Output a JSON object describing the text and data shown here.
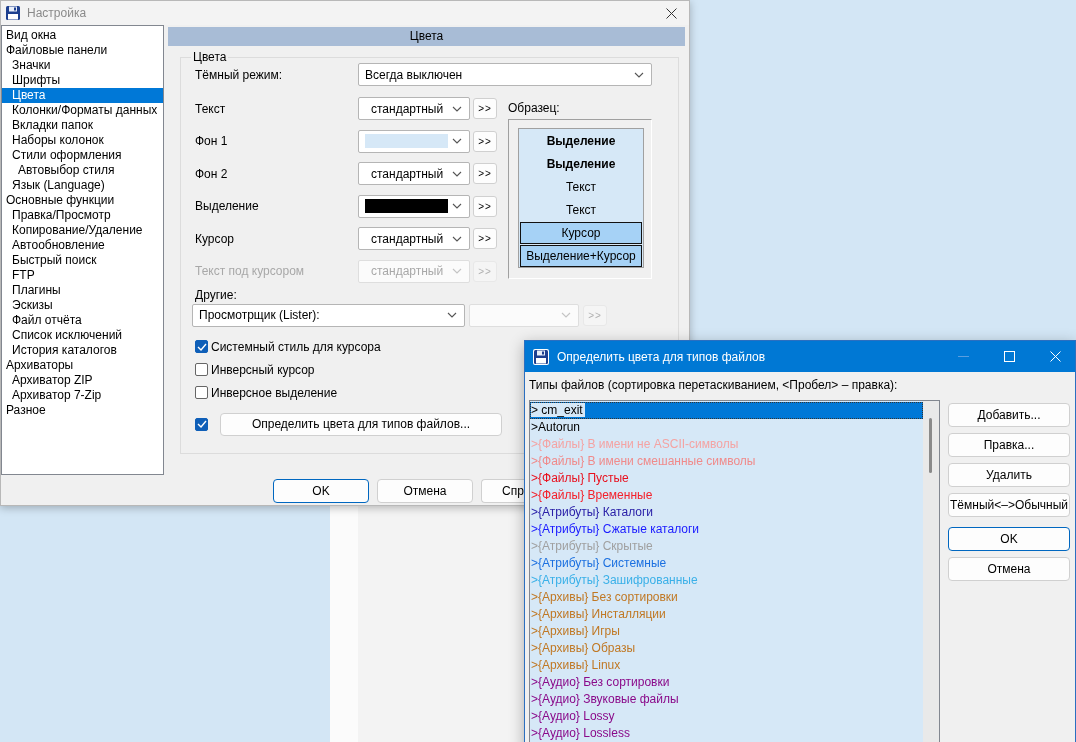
{
  "main_window": {
    "title": "Настройка",
    "tree": [
      {
        "label": "Вид окна",
        "selected": false
      },
      {
        "label": "Файловые панели",
        "selected": false,
        "children": [
          {
            "label": "Значки",
            "selected": false
          },
          {
            "label": "Шрифты",
            "selected": false
          },
          {
            "label": "Цвета",
            "selected": true
          },
          {
            "label": "Колонки/Форматы данных",
            "selected": false
          },
          {
            "label": "Вкладки папок",
            "selected": false
          },
          {
            "label": "Наборы колонок",
            "selected": false
          },
          {
            "label": "Стили оформления",
            "selected": false,
            "children": [
              {
                "label": "Автовыбор стиля",
                "selected": false
              }
            ]
          },
          {
            "label": "Язык (Language)",
            "selected": false
          }
        ]
      },
      {
        "label": "Основные функции",
        "selected": false,
        "children": [
          {
            "label": "Правка/Просмотр",
            "selected": false
          },
          {
            "label": "Копирование/Удаление",
            "selected": false
          },
          {
            "label": "Автообновление",
            "selected": false
          },
          {
            "label": "Быстрый поиск",
            "selected": false
          },
          {
            "label": "FTP",
            "selected": false
          },
          {
            "label": "Плагины",
            "selected": false
          },
          {
            "label": "Эскизы",
            "selected": false
          },
          {
            "label": "Файл отчёта",
            "selected": false
          },
          {
            "label": "Список исключений",
            "selected": false
          },
          {
            "label": "История каталогов",
            "selected": false
          }
        ]
      },
      {
        "label": "Архиваторы",
        "selected": false,
        "children": [
          {
            "label": "Архиватор ZIP",
            "selected": false
          },
          {
            "label": "Архиватор 7-Zip",
            "selected": false
          }
        ]
      },
      {
        "label": "Разное",
        "selected": false
      }
    ],
    "section_header": "Цвета",
    "group": {
      "legend": "Цвета",
      "dark_mode": {
        "label": "Тёмный режим:",
        "value": "Всегда выключен"
      },
      "color_rows": [
        {
          "label": "Текст",
          "kind": "text",
          "value": "стандартный",
          "button": ">>",
          "disabled": false
        },
        {
          "label": "Фон 1",
          "kind": "swatch",
          "color": "#d6e8f7",
          "button": ">>",
          "disabled": false
        },
        {
          "label": "Фон 2",
          "kind": "text",
          "value": "стандартный",
          "button": ">>",
          "disabled": false
        },
        {
          "label": "Выделение",
          "kind": "swatch",
          "color": "#000000",
          "button": ">>",
          "disabled": false
        },
        {
          "label": "Курсор",
          "kind": "text",
          "value": "стандартный",
          "button": ">>",
          "disabled": false
        },
        {
          "label": "Текст под курсором",
          "kind": "text",
          "value": "стандартный",
          "button": ">>",
          "disabled": true
        }
      ],
      "sample": {
        "label": "Образец:",
        "lines": [
          {
            "text": "Выделение",
            "kind": "bold"
          },
          {
            "text": "Выделение",
            "kind": "bold"
          },
          {
            "text": "Текст",
            "kind": "plain"
          },
          {
            "text": "Текст",
            "kind": "plain"
          },
          {
            "text": "Курсор",
            "kind": "cursor"
          },
          {
            "text": "Выделение+Курсор",
            "kind": "cursor"
          }
        ]
      },
      "others": {
        "label": "Другие:",
        "viewer": "Просмотрщик (Lister):",
        "button": ">>"
      },
      "checkboxes": [
        {
          "label": "Системный стиль для курсора",
          "checked": true
        },
        {
          "label": "Инверсный курсор",
          "checked": false
        },
        {
          "label": "Инверсное выделение",
          "checked": false
        }
      ],
      "file_types": {
        "checked": true,
        "button": "Определить цвета для типов файлов..."
      }
    },
    "buttons": [
      {
        "label": "OK",
        "default": true
      },
      {
        "label": "Отмена",
        "default": false
      },
      {
        "label": "Спр",
        "default": false
      }
    ]
  },
  "file_types_window": {
    "title": "Определить цвета для типов файлов",
    "list_label": "Типы файлов (сортировка перетаскиванием, <Пробел> – правка):",
    "items": [
      {
        "text": "> cm_exit",
        "color": "#000000",
        "selected": true
      },
      {
        "text": ">Autorun",
        "color": "#000000",
        "selected": false
      },
      {
        "text": ">{Файлы} В имени не ASCII-символы",
        "color": "#f4a3a3",
        "selected": false
      },
      {
        "text": ">{Файлы} В имени смешанные символы",
        "color": "#f08a8a",
        "selected": false
      },
      {
        "text": ">{Файлы} Пустые",
        "color": "#e8101e",
        "selected": false
      },
      {
        "text": ">{Файлы} Временные",
        "color": "#f4202a",
        "selected": false
      },
      {
        "text": ">{Атрибуты} Каталоги",
        "color": "#2a20a8",
        "selected": false
      },
      {
        "text": ">{Атрибуты} Сжатые каталоги",
        "color": "#1a1aff",
        "selected": false
      },
      {
        "text": ">{Атрибуты} Скрытые",
        "color": "#a0a0a0",
        "selected": false
      },
      {
        "text": ">{Атрибуты} Системные",
        "color": "#1c70e0",
        "selected": false
      },
      {
        "text": ">{Атрибуты} Зашифрованные",
        "color": "#3ab0e8",
        "selected": false
      },
      {
        "text": ">{Архивы} Без сортировки",
        "color": "#c07824",
        "selected": false
      },
      {
        "text": ">{Архивы} Инсталляции",
        "color": "#c07824",
        "selected": false
      },
      {
        "text": ">{Архивы} Игры",
        "color": "#c07824",
        "selected": false
      },
      {
        "text": ">{Архивы} Образы",
        "color": "#c07824",
        "selected": false
      },
      {
        "text": ">{Архивы} Linux",
        "color": "#c07824",
        "selected": false
      },
      {
        "text": ">{Аудио} Без сортировки",
        "color": "#8a0a8a",
        "selected": false
      },
      {
        "text": ">{Аудио} Звуковые файлы",
        "color": "#8a0a8a",
        "selected": false
      },
      {
        "text": ">{Аудио} Lossy",
        "color": "#8a0a8a",
        "selected": false
      },
      {
        "text": ">{Аудио} Lossless",
        "color": "#8a0a8a",
        "selected": false
      }
    ],
    "buttons": [
      {
        "label": "Добавить...",
        "default": false
      },
      {
        "label": "Правка...",
        "default": false
      },
      {
        "label": "Удалить",
        "default": false
      },
      {
        "label": "Тёмный<–>Обычный",
        "default": false
      },
      {
        "label": "OK",
        "default": true
      },
      {
        "label": "Отмена",
        "default": false
      }
    ]
  }
}
